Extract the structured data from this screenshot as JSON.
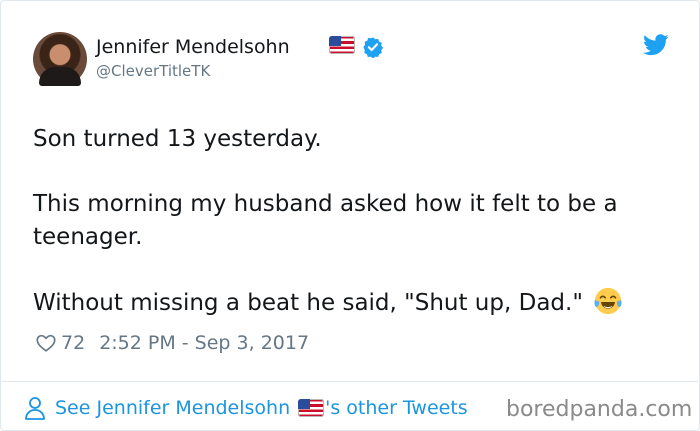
{
  "author": {
    "name": "Jennifer Mendelsohn",
    "handle": "@CleverTitleTK",
    "flag_icon": "us-flag-emoji",
    "verified_icon": "verified-badge-icon"
  },
  "tweet": {
    "paragraphs": [
      "Son turned 13 yesterday.",
      "This morning my husband asked how it felt to  be a teenager.",
      "Without missing a beat he said, \"Shut up, Dad.\""
    ],
    "emoji": "tears-of-joy-emoji",
    "likes": "72",
    "timestamp": "2:52 PM - Sep 3, 2017"
  },
  "footer": {
    "link_prefix": "See Jennifer Mendelsohn",
    "link_suffix": "'s other Tweets",
    "watermark": "boredpanda.com"
  },
  "colors": {
    "twitter_blue": "#1b95e0",
    "muted_gray": "#657786",
    "text": "#14171a"
  }
}
